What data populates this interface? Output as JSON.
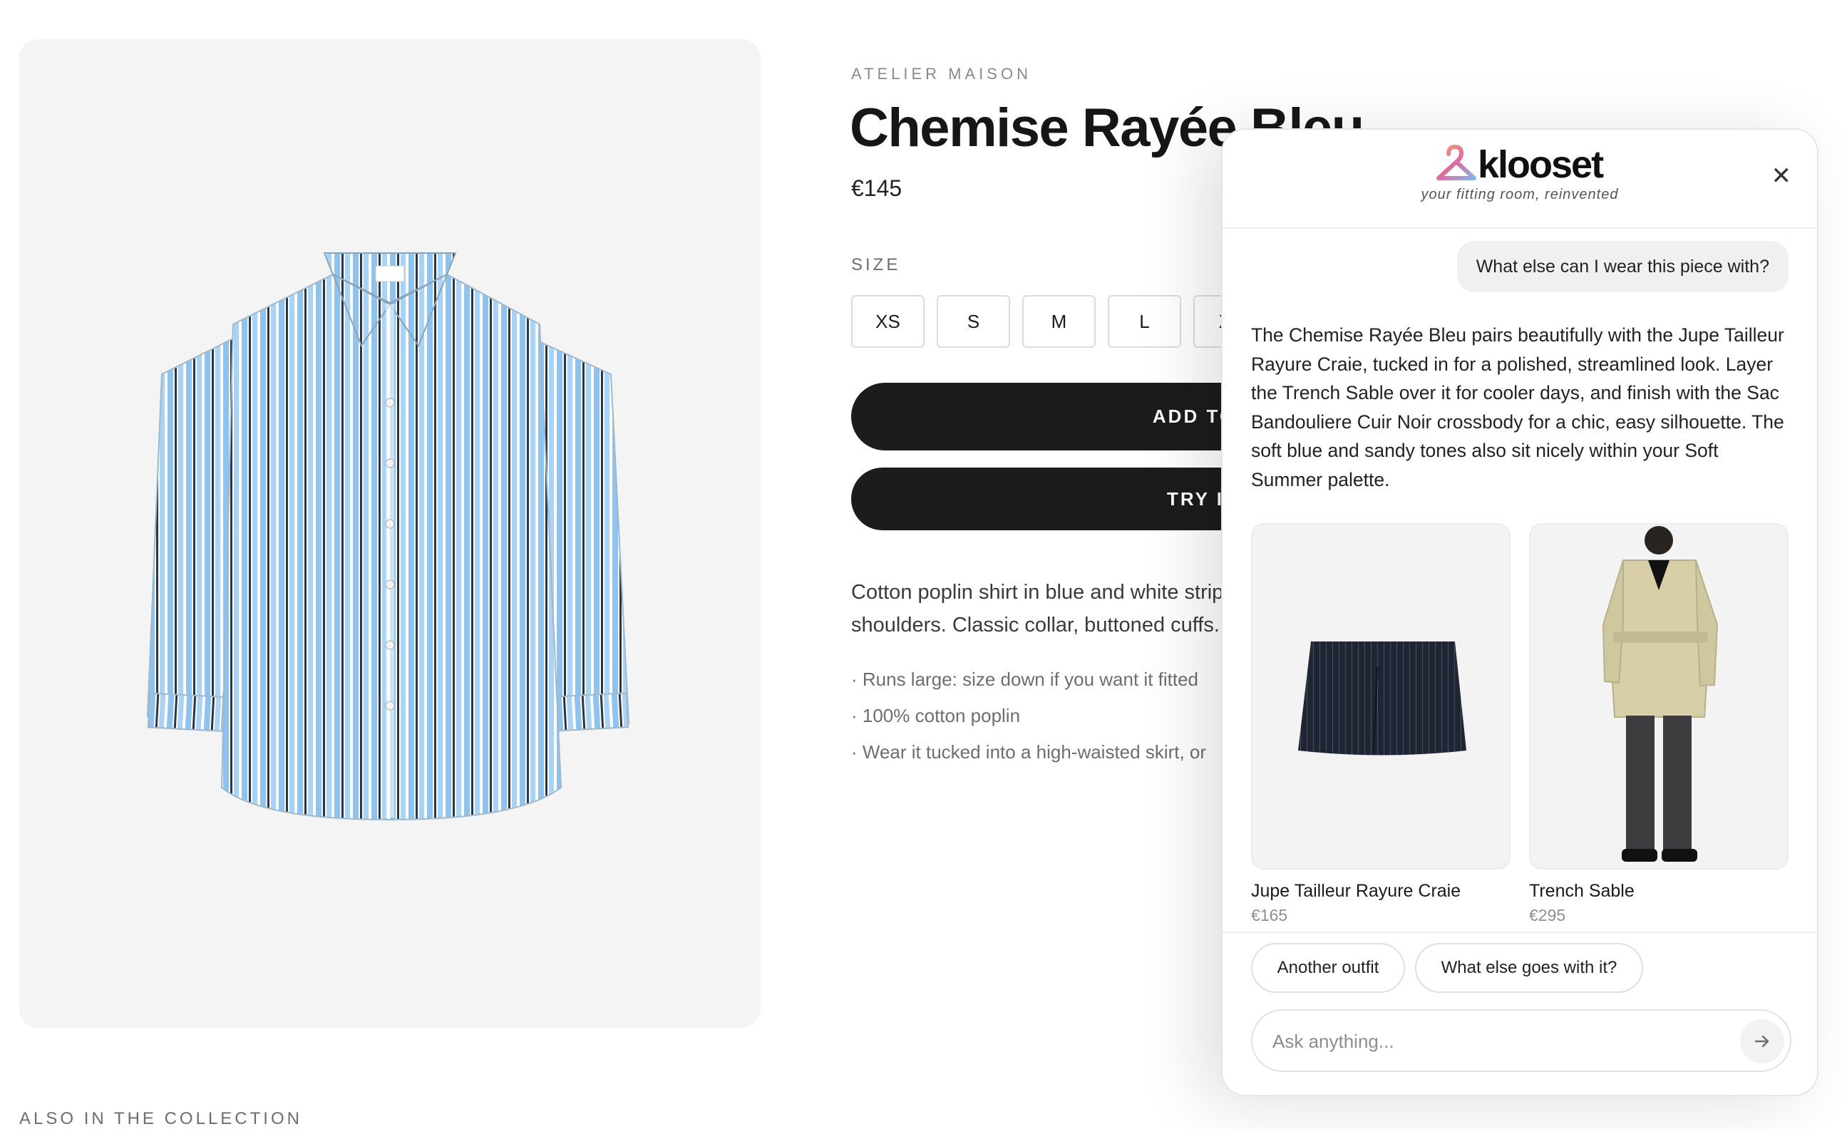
{
  "product": {
    "brand": "ATELIER MAISON",
    "title": "Chemise Rayée Bleu",
    "price": "€145",
    "size_label": "SIZE",
    "sizes": [
      "XS",
      "S",
      "M",
      "L",
      "XL"
    ],
    "add_button": "ADD TO BAG",
    "try_button": "TRY IT ON",
    "description": "Cotton poplin shirt in blue and white stripes with a relaxed fit and dropped shoulders. Classic collar, buttoned cuffs.",
    "bullets": [
      "· Runs large: size down if you want it fitted",
      "· 100% cotton poplin",
      "· Wear it tucked into a high-waisted skirt, or"
    ]
  },
  "collection": {
    "label": "ALSO IN THE COLLECTION"
  },
  "chat": {
    "logo_text": "klooset",
    "tagline": "your fitting room, reinvented",
    "close_symbol": "✕",
    "user_message": "What else can I wear this piece with?",
    "assistant_message": "The Chemise Rayée Bleu pairs beautifully with the Jupe Tailleur Rayure Craie, tucked in for a polished, streamlined look. Layer the Trench Sable over it for cooler days, and finish with the Sac Bandouliere Cuir Noir crossbody for a chic, easy silhouette. The soft blue and sandy tones also sit nicely within your Soft Summer palette.",
    "products": [
      {
        "name": "Jupe Tailleur Rayure Craie",
        "price": "€165"
      },
      {
        "name": "Trench Sable",
        "price": "€295"
      }
    ],
    "suggestions": [
      "Another outfit",
      "What else goes with it?"
    ],
    "input_placeholder": "Ask anything...",
    "send_icon": "arrow-right-icon"
  },
  "colors": {
    "button_dark": "#1c1c1c",
    "shirt_blue": "#8ec3ef",
    "shirt_navy": "#2b3548",
    "logo_gradient": [
      "#f0a07a",
      "#e06aa0",
      "#7fb6e8"
    ]
  }
}
